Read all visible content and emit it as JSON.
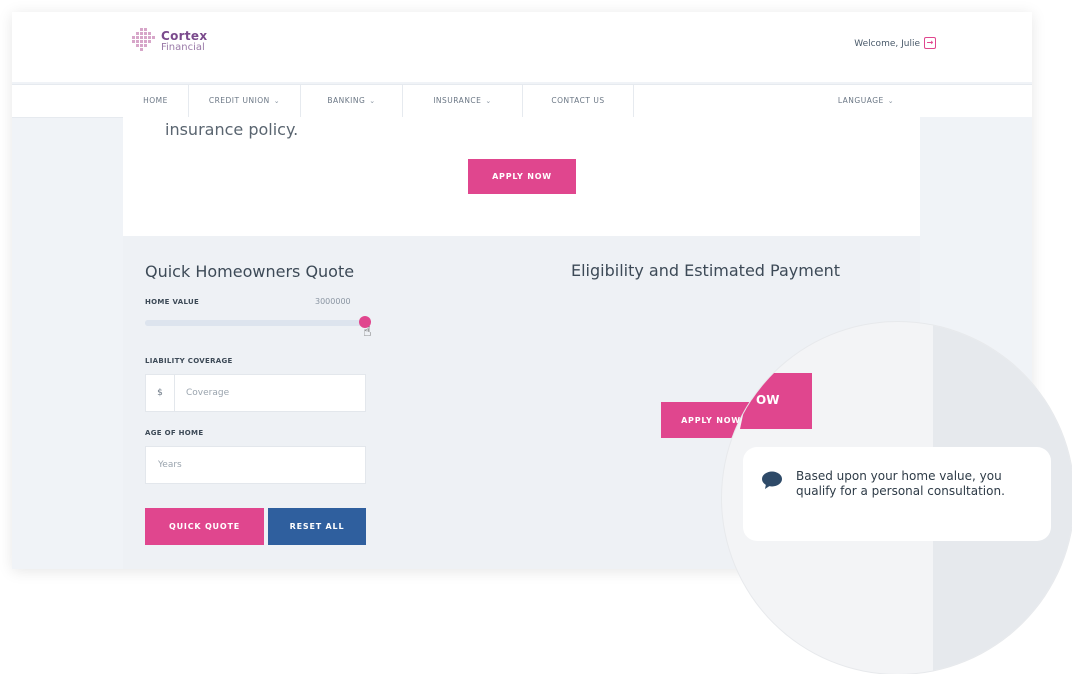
{
  "brand": {
    "name": "Cortex",
    "sub": "Financial"
  },
  "header": {
    "welcome": "Welcome, Julie",
    "signout_icon": "sign-out-icon"
  },
  "nav": {
    "items": [
      {
        "label": "HOME",
        "dropdown": false
      },
      {
        "label": "CREDIT UNION",
        "dropdown": true
      },
      {
        "label": "BANKING",
        "dropdown": true
      },
      {
        "label": "INSURANCE",
        "dropdown": true
      },
      {
        "label": "CONTACT US",
        "dropdown": false
      }
    ],
    "language": "LANGUAGE"
  },
  "top_section": {
    "text": "insurance policy.",
    "apply_label": "APPLY NOW"
  },
  "quote": {
    "title": "Quick Homeowners Quote",
    "home_value_label": "HOME VALUE",
    "home_value": "3000000",
    "slider_level": 1.0,
    "liability_label": "LIABILITY COVERAGE",
    "liability_prefix": "$",
    "liability_placeholder": "Coverage",
    "age_label": "AGE OF HOME",
    "age_placeholder": "Years",
    "quick_quote_label": "QUICK QUOTE",
    "reset_label": "RESET ALL"
  },
  "eligibility": {
    "title": "Eligibility and Estimated Payment",
    "apply_label": "APPLY NOW"
  },
  "magnifier": {
    "button_fragment": "OW"
  },
  "tooltip": {
    "text": "Based upon your home value, you qualify for a personal consultation."
  },
  "colors": {
    "accent_pink": "#e0468e",
    "accent_blue": "#2f5f9e",
    "text_dark": "#3d4a57"
  }
}
